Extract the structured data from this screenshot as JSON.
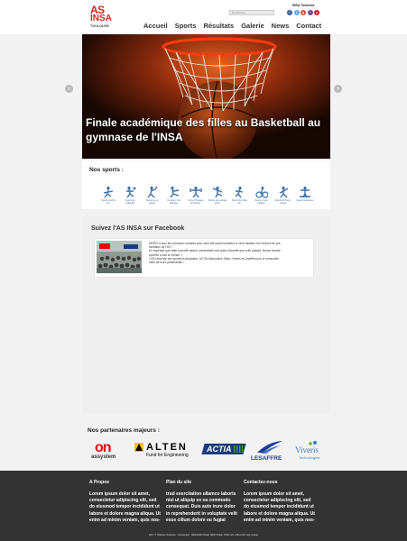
{
  "header": {
    "logo_line1": "AS",
    "logo_line2": "INSA",
    "logo_line3": "TOULOUSE",
    "top_label": "INSA Toulouse",
    "search_placeholder": "Recherche",
    "socials": [
      {
        "icon": "facebook-icon",
        "glyph": "f",
        "color": "#3b5998"
      },
      {
        "icon": "twitter-icon",
        "glyph": "t",
        "color": "#55acee"
      },
      {
        "icon": "googleplus-icon",
        "glyph": "g",
        "color": "#dd4b39"
      },
      {
        "icon": "instagram-icon",
        "glyph": "i",
        "color": "#5f4b8b"
      },
      {
        "icon": "youtube-icon",
        "glyph": "y",
        "color": "#cc181e"
      }
    ],
    "nav": [
      "Accueil",
      "Sports",
      "Résultats",
      "Galerie",
      "News",
      "Contact"
    ]
  },
  "hero": {
    "caption": "Finale académique des filles au Basketball au gymnase de l'INSA",
    "prev": "‹",
    "next": "›"
  },
  "sports": {
    "title": "Nos sports :",
    "items": [
      {
        "icon": "swimming-icon",
        "label": "Sports à effort\nfini"
      },
      {
        "icon": "team-sports-icon",
        "label": "Sports de\ncollectifs"
      },
      {
        "icon": "racket-sports-icon",
        "label": "Sports de et\nraquet"
      },
      {
        "icon": "combat-icon",
        "label": "Combat / Arts\nMartiaux"
      },
      {
        "icon": "fitness-icon",
        "label": "Force Physique\n& Fitness"
      },
      {
        "icon": "dance-icon",
        "label": "Sports de pratique\nartist."
      },
      {
        "icon": "outdoor-icon",
        "label": "Sports de Plein\nAir"
      },
      {
        "icon": "cycling-icon",
        "label": "Sports Cross\nlointain"
      },
      {
        "icon": "climbing-icon",
        "label": "Sports de Cons-\ncience"
      },
      {
        "icon": "water-sports-icon",
        "label": "Sports Nautiques"
      }
    ]
  },
  "facebook": {
    "title": "Suivez l'AS INSA sur Facebook",
    "post": "MERCI à tous les nouveaux entrants pour avoir été aussi nombreux à venir assister à la réunion de pré-\nsentation de l'AS !\nEn espérant que cette nouvelle saison universitaire soit aussi chouette que celle passée. Bonne reprise\nsportive à tout le monde :)\nL'AS remercie ses sponsors Assystem, ACTIA Automotive, Alten, Viveris et Lesaffre pour le renouvelle-\nment de leurs partenariats !"
  },
  "partners": {
    "title": "Nos partenaires majeurs :",
    "logos": [
      {
        "name": "assystem",
        "text": "assystem",
        "color": "#e30613"
      },
      {
        "name": "alten",
        "text": "ALTEN",
        "sub": "Fund for Engineering",
        "color": "#000000"
      },
      {
        "name": "actia",
        "text": "ACTIA",
        "color": "#1a3b7c"
      },
      {
        "name": "lesaffre",
        "text": "LESAFFRE",
        "color": "#1a3b9c"
      },
      {
        "name": "viveris",
        "text": "Viveris",
        "sub": "Technologies",
        "color": "#3b7cc0"
      }
    ]
  },
  "footer": {
    "columns": [
      {
        "title": "A Propos",
        "text": "Lorem ipsum dolor sit amet, consectetur adipiscing elit, sed do eiusmod tempor incididunt ut labore et dolore magna aliqua. Ut enim ad minim veniam, quis nos-"
      },
      {
        "title": "Plan du site",
        "text": "trud exercitation ullamco laboris nisi ut aliquip ex ea commodo consequat. Duis aute irure dolor in reprehenderit in voluptate velit esse cillum dolore eu fugiat"
      },
      {
        "title": "Contactez-nous",
        "text": "Lorem ipsum dolor sit amet, consectetur adipiscing elit, sed do eiusmod tempor incididunt ut labore et dolore magna aliqua. Ut enim ad minim veniam, quis nos-"
      }
    ],
    "copyright": "2017 © INSA de Toulouse · Conception : REDHAWI Khalil, ABID Sofian, PIAN Aliz, Adil et DO Huy Hoang"
  },
  "colors": {
    "brand_red": "#d9251d",
    "sport_blue": "#3b6ea8",
    "footer_bg": "#333333"
  }
}
